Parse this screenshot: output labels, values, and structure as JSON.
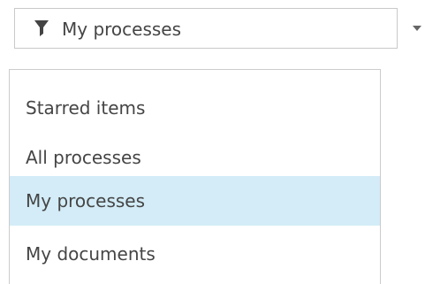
{
  "filter": {
    "icon": "funnel-icon",
    "selected_label": "My processes"
  },
  "menu": {
    "items": [
      {
        "label": "Starred items",
        "selected": false
      },
      {
        "label": "All processes",
        "selected": false
      },
      {
        "label": "My processes",
        "selected": true
      },
      {
        "label": "My documents",
        "selected": false
      }
    ]
  },
  "colors": {
    "selected_background": "#d3ecf7",
    "border": "#c9c9c9",
    "text": "#454545"
  }
}
